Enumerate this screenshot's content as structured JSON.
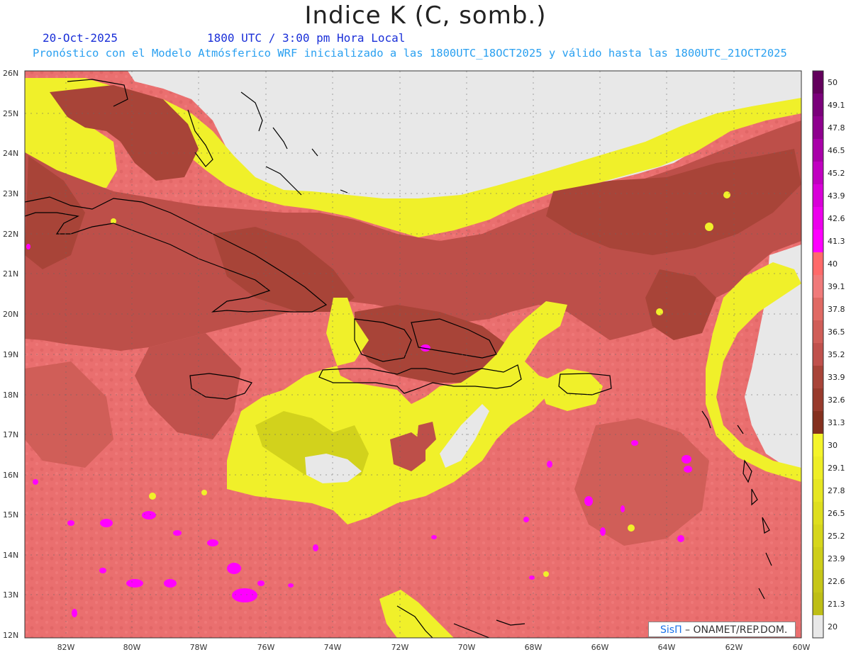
{
  "header": {
    "title": "Indice K (C, somb.)",
    "date": "20-Oct-2025",
    "time": "1800 UTC / 3:00 pm Hora Local",
    "description": "Pronóstico con el Modelo Atmósferico WRF inicializado a las 1800UTC_18OCT2025 y válido hasta las  1800UTC_21OCT2025"
  },
  "map": {
    "lat_labels": [
      "26N",
      "25N",
      "24N",
      "23N",
      "22N",
      "21N",
      "20N",
      "19N",
      "18N",
      "17N",
      "16N",
      "15N",
      "14N",
      "13N",
      "12N"
    ],
    "lon_labels": [
      "82W",
      "80W",
      "78W",
      "76W",
      "74W",
      "72W",
      "70W",
      "68W",
      "66W",
      "64W",
      "62W",
      "60W"
    ],
    "colors": {
      "pink": "#ea6f6f",
      "brown": "#bd4f49",
      "dark_brown": "#8c3a2c",
      "yellow": "#f0f02a",
      "olive": "#d2d21c",
      "gray": "#e8e8e8",
      "magenta": "#ff00ff"
    }
  },
  "colorbar": {
    "labels": [
      "50",
      "49.1",
      "47.8",
      "46.5",
      "45.2",
      "43.9",
      "42.6",
      "41.3",
      "40",
      "39.1",
      "37.8",
      "36.5",
      "35.2",
      "33.9",
      "32.6",
      "31.3",
      "30",
      "29.1",
      "27.8",
      "26.5",
      "25.2",
      "23.9",
      "22.6",
      "21.3",
      "20"
    ],
    "colors": [
      "#63005c",
      "#7a007a",
      "#8e008e",
      "#a800a8",
      "#c000c0",
      "#d800d8",
      "#ec00ec",
      "#ff00ff",
      "#ff6a6a",
      "#f07a7a",
      "#e06a64",
      "#d05e58",
      "#c0514c",
      "#a84438",
      "#983a2c",
      "#84301e",
      "#f4f42a",
      "#eeee26",
      "#e6e622",
      "#dede1e",
      "#d6d61c",
      "#cece1a",
      "#c6c618",
      "#bebe16",
      "#e8e8e8"
    ]
  },
  "credit": {
    "sis": "SisΠ",
    "org": " – ONAMET/REP.DOM."
  }
}
